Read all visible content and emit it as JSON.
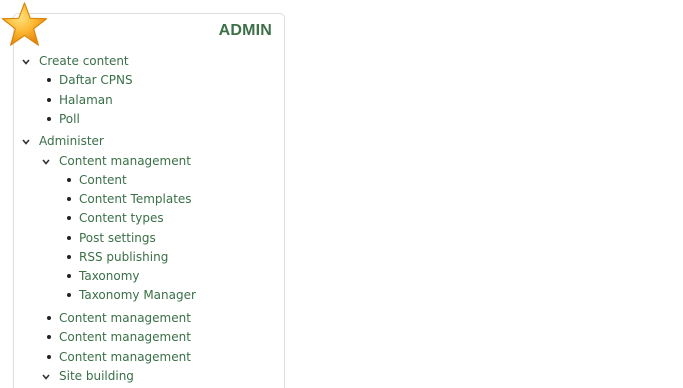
{
  "block": {
    "title": "ADMIN"
  },
  "menu": {
    "create_content": "Create content",
    "create_items": [
      "Daftar CPNS",
      "Halaman",
      "Poll"
    ],
    "administer": "Administer",
    "content_management": "Content management",
    "cm_items": [
      "Content",
      "Content Templates",
      "Content types",
      "Post settings",
      "RSS publishing",
      "Taxonomy",
      "Taxonomy Manager"
    ],
    "more_items": [
      "Content management",
      "Content management",
      "Content management"
    ],
    "site_building": "Site building"
  },
  "colors": {
    "title": "#3c7046",
    "link": "#3a6f47",
    "border": "#dedede",
    "star": "#f7a21b"
  },
  "icons": {
    "logo": "star-icon",
    "expanded": "chevron-down-icon",
    "leaf": "bullet-icon"
  }
}
